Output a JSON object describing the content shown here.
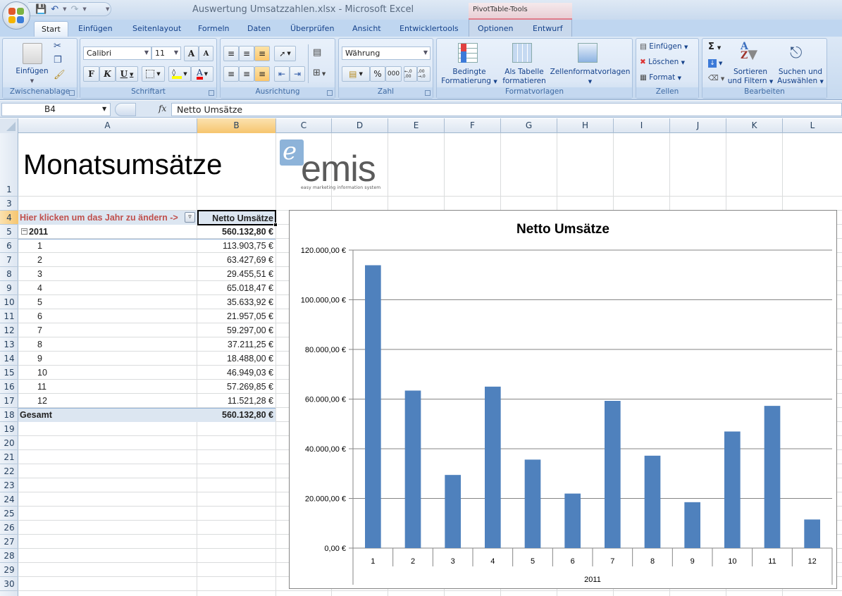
{
  "window": {
    "title": "Auswertung Umsatzzahlen.xlsx - Microsoft Excel",
    "context_tab_group": "PivotTable-Tools"
  },
  "quick_access": {
    "save": "save-icon",
    "undo": "undo-icon",
    "redo": "redo-icon"
  },
  "tabs": [
    {
      "label": "Start",
      "active": true
    },
    {
      "label": "Einfügen"
    },
    {
      "label": "Seitenlayout"
    },
    {
      "label": "Formeln"
    },
    {
      "label": "Daten"
    },
    {
      "label": "Überprüfen"
    },
    {
      "label": "Ansicht"
    },
    {
      "label": "Entwicklertools"
    },
    {
      "label": "Optionen"
    },
    {
      "label": "Entwurf"
    }
  ],
  "ribbon": {
    "clipboard": {
      "label": "Zwischenablage",
      "paste": "Einfügen"
    },
    "font": {
      "label": "Schriftart",
      "font_name": "Calibri",
      "font_size": "11",
      "bold": "F",
      "italic": "K",
      "underline": "U",
      "grow": "A",
      "shrink": "A",
      "font_color_letter": "A"
    },
    "alignment": {
      "label": "Ausrichtung"
    },
    "number": {
      "label": "Zahl",
      "format": "Währung",
      "percent": "%",
      "thousands": "000",
      "inc_decimal": "←,0 ,00",
      "dec_decimal": ",00 →,0"
    },
    "styles": {
      "label": "Formatvorlagen",
      "conditional_line1": "Bedingte",
      "conditional_line2": "Formatierung",
      "as_table_line1": "Als Tabelle",
      "as_table_line2": "formatieren",
      "cell_styles": "Zellenformatvorlagen"
    },
    "cells": {
      "label": "Zellen",
      "insert": "Einfügen",
      "delete": "Löschen",
      "format": "Format"
    },
    "editing": {
      "label": "Bearbeiten",
      "sum": "Σ",
      "sort_line1": "Sortieren",
      "sort_line2": "und Filtern",
      "find_line1": "Suchen und",
      "find_line2": "Auswählen"
    }
  },
  "formula_bar": {
    "name_box": "B4",
    "fx": "fx",
    "content": "Netto Umsätze"
  },
  "columns": [
    "A",
    "B",
    "C",
    "D",
    "E",
    "F",
    "G",
    "H",
    "I",
    "J",
    "K",
    "L"
  ],
  "selected_column": "B",
  "rows": [
    "1",
    "3",
    "4",
    "5",
    "6",
    "7",
    "8",
    "9",
    "10",
    "11",
    "12",
    "13",
    "14",
    "15",
    "16",
    "17",
    "18",
    "19",
    "20",
    "21",
    "22",
    "23",
    "24",
    "25",
    "26",
    "27",
    "28",
    "29",
    "30"
  ],
  "selected_row": "4",
  "sheet": {
    "title": "Monatsumsätze",
    "logo": {
      "letter": "e",
      "name": "emis",
      "tagline": "easy marketing information system"
    }
  },
  "pivot": {
    "filter_label": "Hier klicken um das Jahr zu ändern ->",
    "value_header": "Netto Umsätze",
    "year": "2011",
    "year_total": "560.132,80 €",
    "months": [
      {
        "month": "1",
        "value": "113.903,75 €"
      },
      {
        "month": "2",
        "value": "63.427,69 €"
      },
      {
        "month": "3",
        "value": "29.455,51 €"
      },
      {
        "month": "4",
        "value": "65.018,47 €"
      },
      {
        "month": "5",
        "value": "35.633,92 €"
      },
      {
        "month": "6",
        "value": "21.957,05 €"
      },
      {
        "month": "7",
        "value": "59.297,00 €"
      },
      {
        "month": "8",
        "value": "37.211,25 €"
      },
      {
        "month": "9",
        "value": "18.488,00 €"
      },
      {
        "month": "10",
        "value": "46.949,03 €"
      },
      {
        "month": "11",
        "value": "57.269,85 €"
      },
      {
        "month": "12",
        "value": "11.521,28 €"
      }
    ],
    "total_label": "Gesamt",
    "total_value": "560.132,80 €"
  },
  "chart_data": {
    "type": "bar",
    "title": "Netto Umsätze",
    "categories": [
      "1",
      "2",
      "3",
      "4",
      "5",
      "6",
      "7",
      "8",
      "9",
      "10",
      "11",
      "12"
    ],
    "group_label": "2011",
    "values": [
      113903.75,
      63427.69,
      29455.51,
      65018.47,
      35633.92,
      21957.05,
      59297.0,
      37211.25,
      18488.0,
      46949.03,
      57269.85,
      11521.28
    ],
    "ylim": [
      0,
      120000
    ],
    "yticks": [
      0,
      20000,
      40000,
      60000,
      80000,
      100000,
      120000
    ],
    "ytick_labels": [
      "0,00 €",
      "20.000,00 €",
      "40.000,00 €",
      "60.000,00 €",
      "80.000,00 €",
      "100.000,00 €",
      "120.000,00 €"
    ],
    "xlabel": "",
    "ylabel": "",
    "grid": true,
    "legend": "none",
    "bar_color": "#4f81bd"
  }
}
